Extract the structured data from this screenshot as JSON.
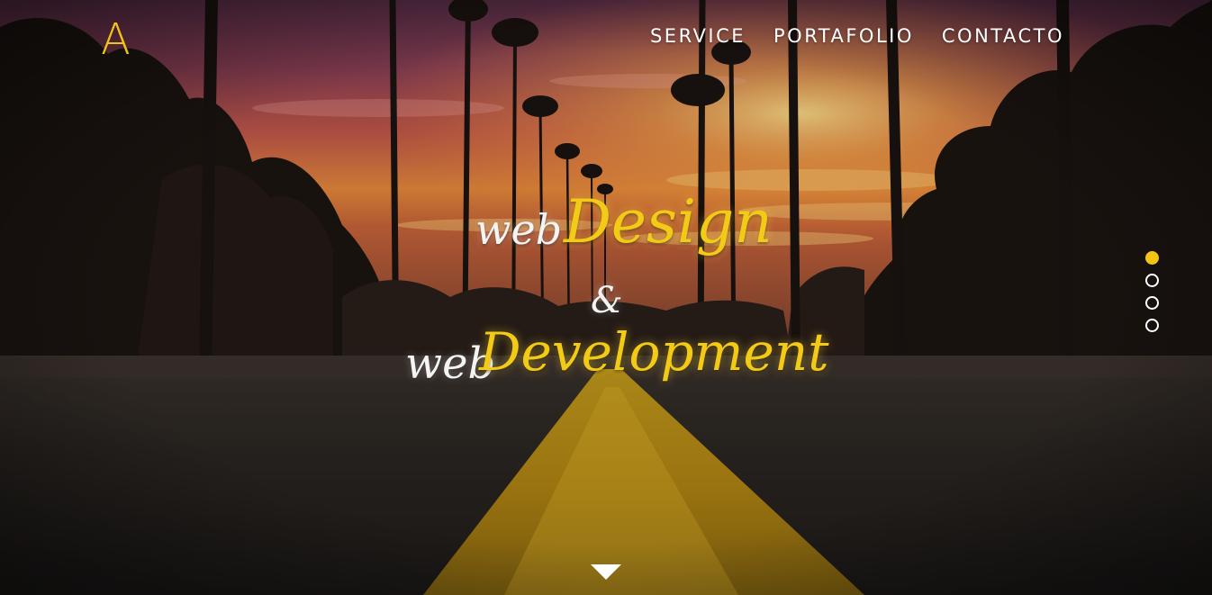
{
  "brand": {
    "logo_letter": "A",
    "accent_color": "#f2c414"
  },
  "nav": {
    "items": [
      {
        "label": "SERVICE"
      },
      {
        "label": "PORTAFOLIO"
      },
      {
        "label": "CONTACTO"
      }
    ]
  },
  "hero": {
    "line1_web": "web",
    "line1_accent": "Design",
    "ampersand": "&",
    "line2_web": "web",
    "line2_accent": "Development"
  },
  "slider": {
    "slide_count": 4,
    "active_index": 0
  },
  "icons": {
    "scroll": "chevron-down-icon"
  }
}
